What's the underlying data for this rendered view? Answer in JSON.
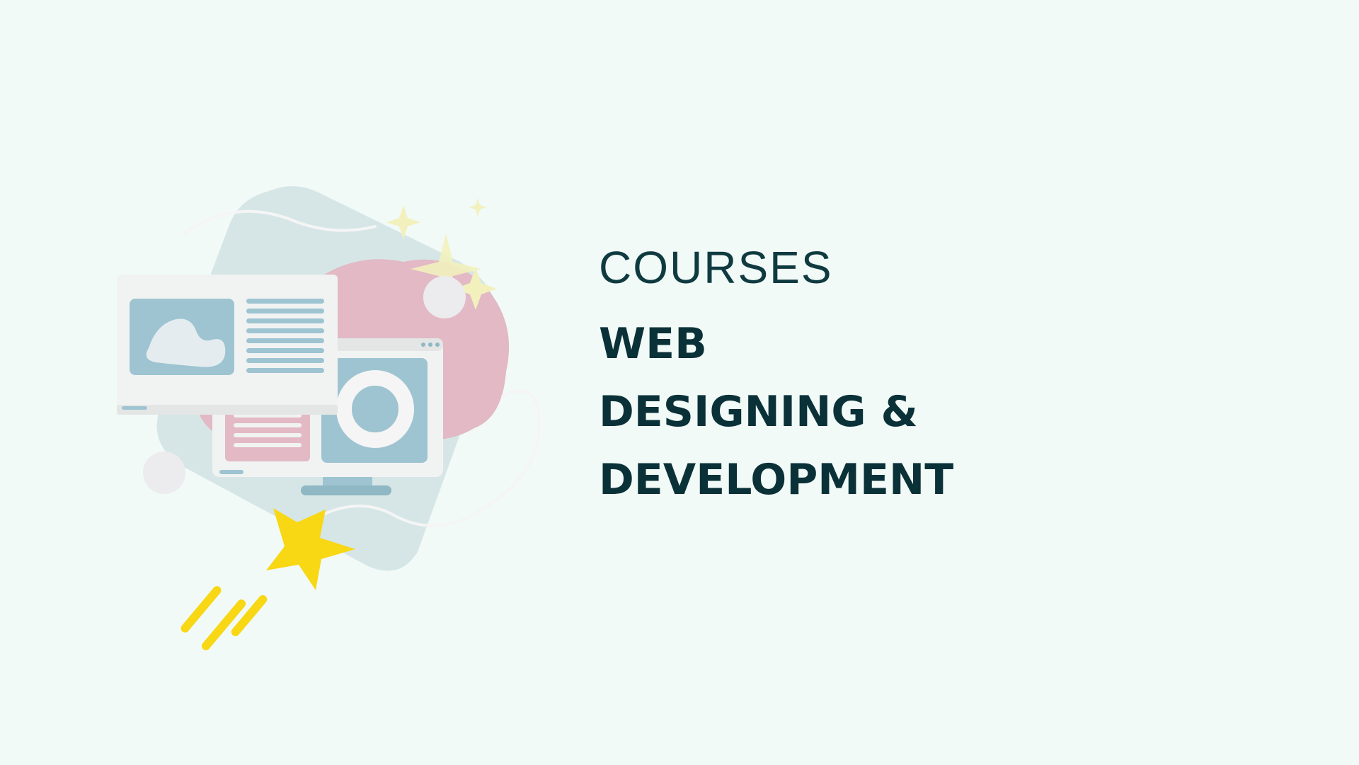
{
  "slide": {
    "eyebrow": "COURSES",
    "title_lines": [
      "WEB",
      "DESIGNING &",
      "DEVELOPMENT"
    ]
  },
  "illustration": {
    "icon": "web-design-illustration",
    "colors": {
      "blob_blue": "#d6e6e6",
      "blob_pink": "#e2b9c5",
      "panel_blue": "#9ec4d1",
      "panel_light": "#f1f3f2",
      "star_yellow": "#f8d714",
      "sparkle_yellow": "#f2f1bd"
    }
  },
  "theme": {
    "background": "#f1faf7",
    "text": "#0b3138"
  }
}
